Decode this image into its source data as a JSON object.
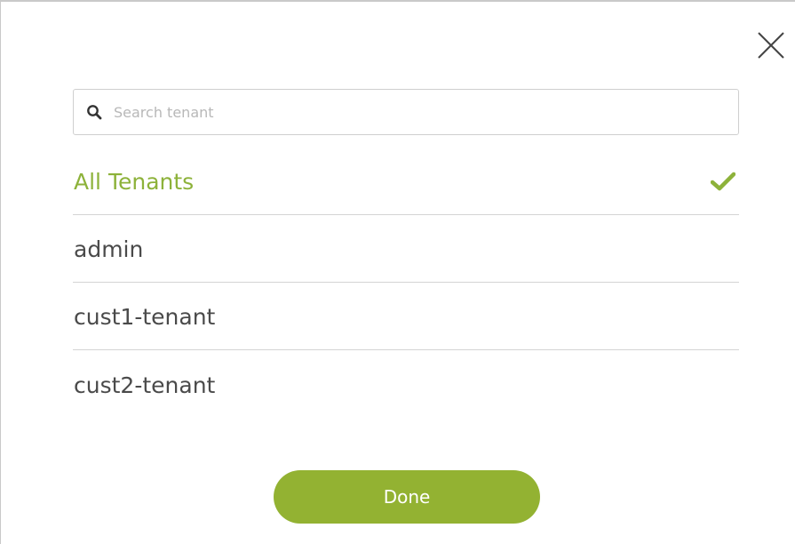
{
  "dialog": {
    "close_icon": "close-icon",
    "search": {
      "placeholder": "Search tenant",
      "value": "",
      "icon": "search-icon"
    },
    "tenants": [
      {
        "label": "All Tenants",
        "selected": true
      },
      {
        "label": "admin",
        "selected": false
      },
      {
        "label": "cust1-tenant",
        "selected": false
      },
      {
        "label": "cust2-tenant",
        "selected": false
      }
    ],
    "check_icon": "check-icon",
    "done_label": "Done"
  },
  "colors": {
    "accent": "#93b232",
    "selected_text": "#8db23a",
    "text": "#4a4a4a",
    "divider": "#d4d4d4"
  }
}
